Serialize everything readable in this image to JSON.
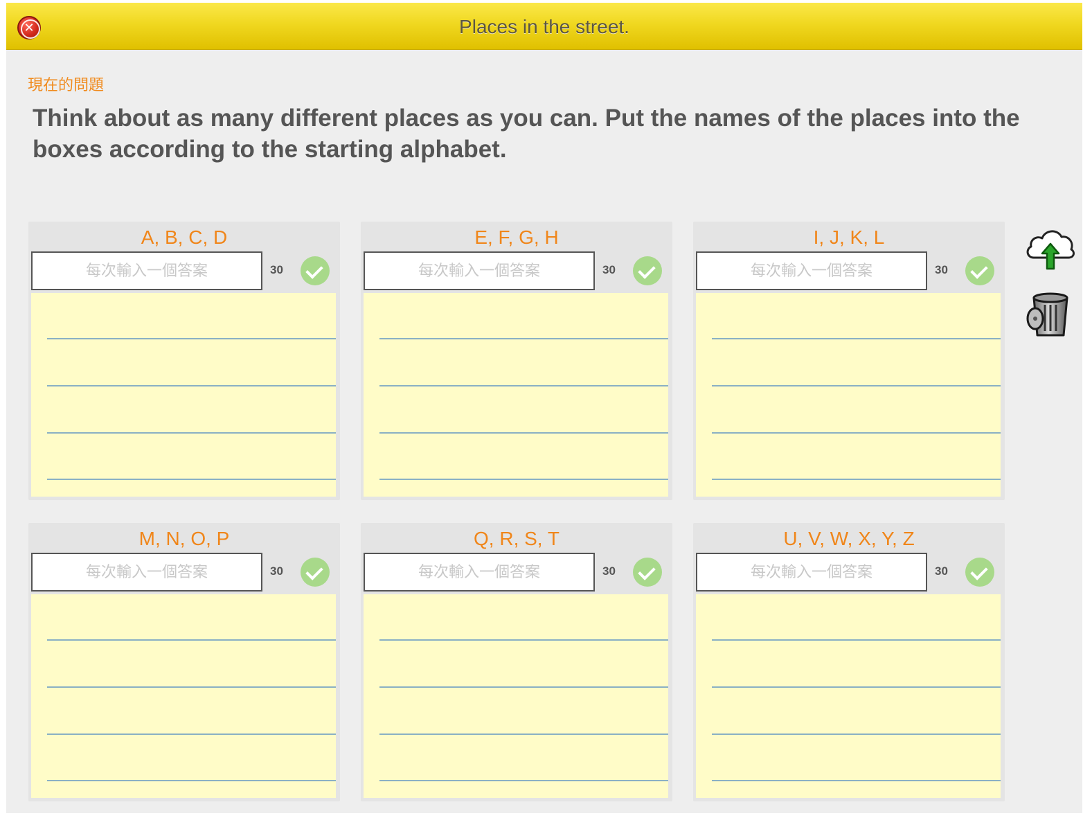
{
  "window": {
    "title": "Places in the street."
  },
  "question": {
    "label": "現在的問題",
    "text": "Think about as many different places as you can. Put the names of the places into the boxes according to the starting alphabet."
  },
  "cards": [
    {
      "title": "A, B, C, D",
      "placeholder": "每次輸入一個答案",
      "count": "30"
    },
    {
      "title": "E, F, G, H",
      "placeholder": "每次輸入一個答案",
      "count": "30"
    },
    {
      "title": "I, J, K, L",
      "placeholder": "每次輸入一個答案",
      "count": "30"
    },
    {
      "title": "M, N, O, P",
      "placeholder": "每次輸入一個答案",
      "count": "30"
    },
    {
      "title": "Q, R, S, T",
      "placeholder": "每次輸入一個答案",
      "count": "30"
    },
    {
      "title": "U, V, W, X, Y, Z",
      "placeholder": "每次輸入一個答案",
      "count": "30"
    }
  ],
  "icons": {
    "close": "close-icon",
    "upload": "cloud-upload-icon",
    "trash": "trash-can-icon"
  },
  "colors": {
    "titlebar": "#f0d820",
    "accent_orange": "#f0861a",
    "pad_yellow": "#fffcc8",
    "check_green": "#a8d98a"
  }
}
